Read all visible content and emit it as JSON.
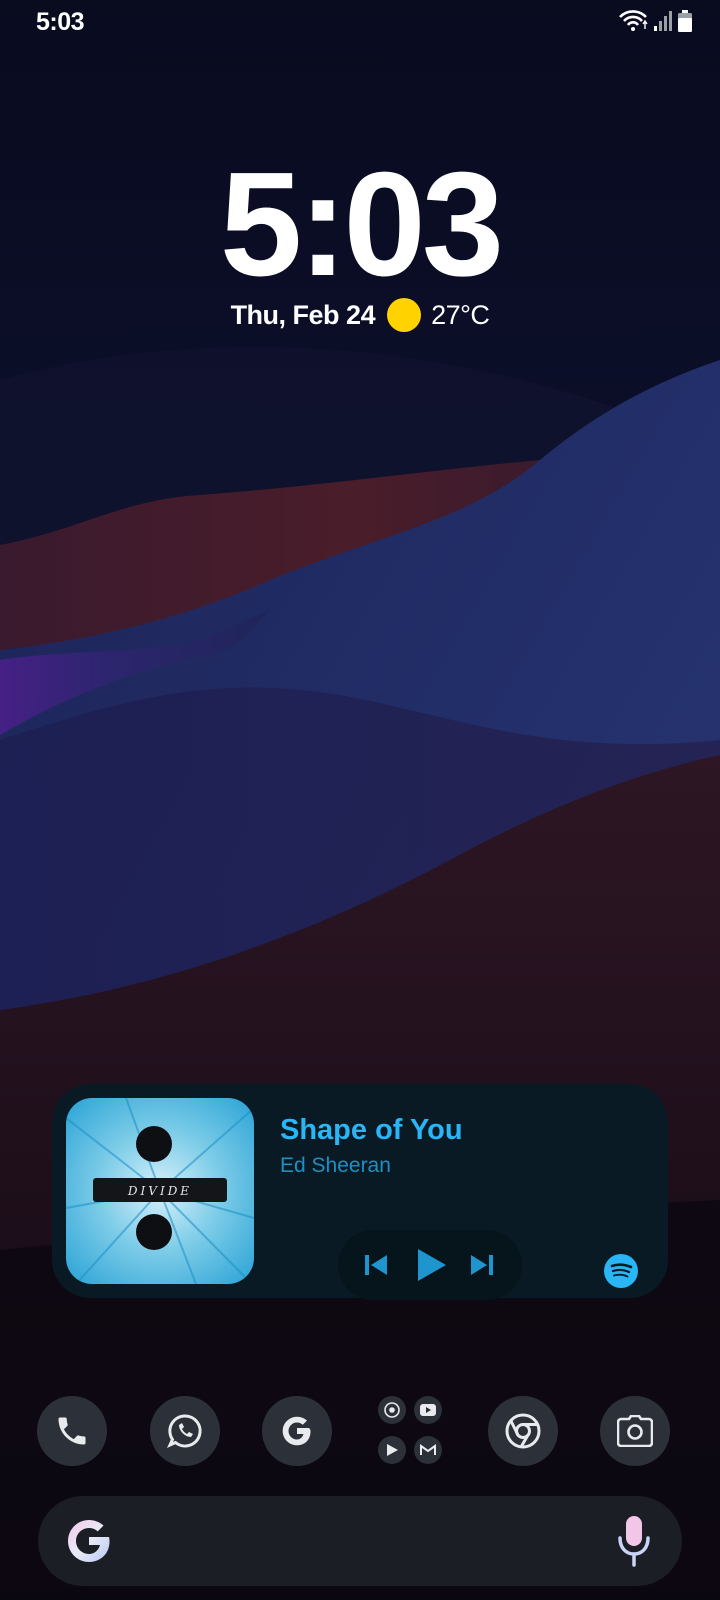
{
  "status_bar": {
    "time": "5:03",
    "icons": [
      "wifi-icon",
      "signal-icon",
      "battery-icon"
    ]
  },
  "lockscreen": {
    "clock": "5:03",
    "date": "Thu, Feb 24",
    "weather_icon": "sun-icon",
    "temperature": "27°C"
  },
  "media_widget": {
    "album_art_text": "DIVIDE",
    "title": "Shape of You",
    "artist": "Ed Sheeran",
    "controls": [
      "previous-icon",
      "play-icon",
      "next-icon"
    ],
    "source_icon": "spotify-icon",
    "accent_color": "#29b6f6"
  },
  "dock": {
    "apps": [
      "phone-icon",
      "whatsapp-icon",
      "google-icon",
      "folder-icon",
      "chrome-icon",
      "camera-icon"
    ],
    "folder_apps": [
      "chrome-icon",
      "youtube-icon",
      "play-store-icon",
      "gmail-icon"
    ]
  },
  "search_bar": {
    "left_icon": "google-icon",
    "right_icon": "mic-icon"
  }
}
